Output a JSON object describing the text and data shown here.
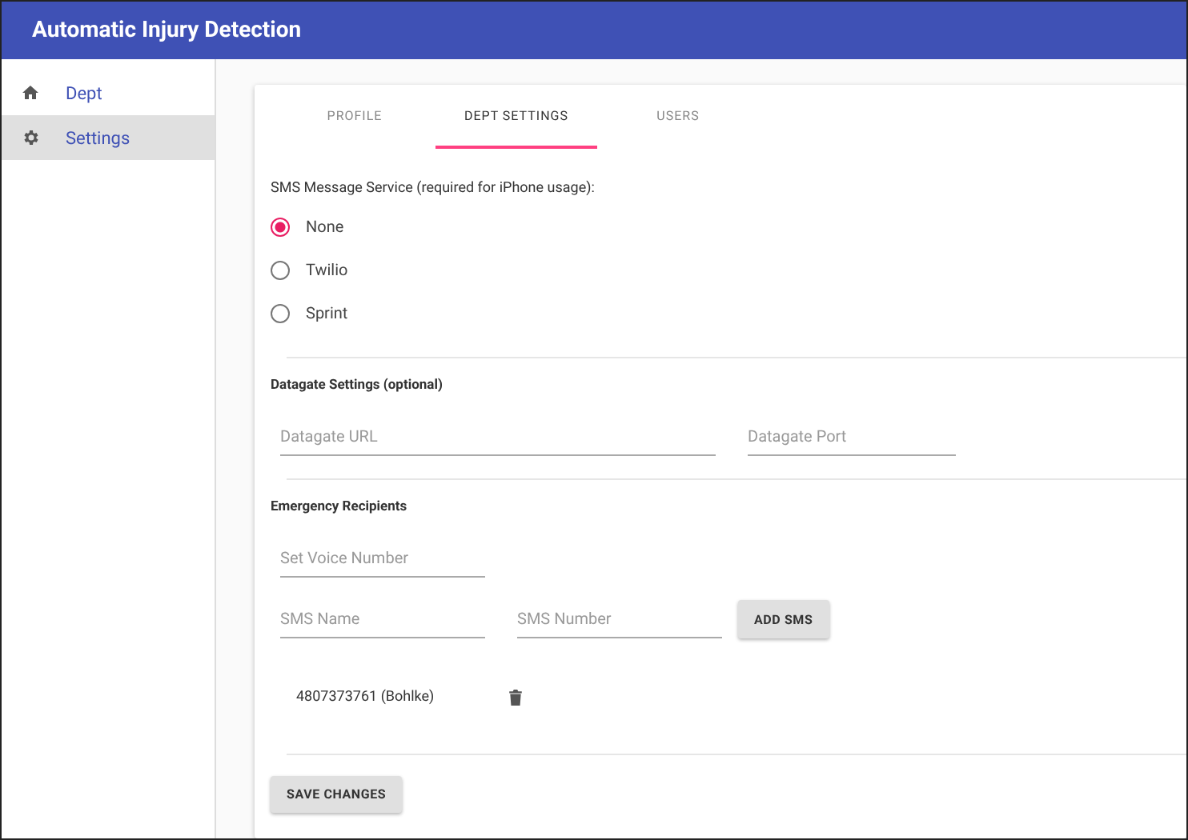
{
  "app_bar": {
    "title": "Automatic Injury Detection"
  },
  "sidebar": {
    "items": [
      {
        "label": "Dept",
        "selected": false
      },
      {
        "label": "Settings",
        "selected": true
      }
    ]
  },
  "tabs": [
    {
      "label": "PROFILE",
      "selected": false
    },
    {
      "label": "DEPT SETTINGS",
      "selected": true
    },
    {
      "label": "USERS",
      "selected": false
    }
  ],
  "sms_service": {
    "label": "SMS Message Service (required for iPhone usage):",
    "options": [
      {
        "label": "None",
        "selected": true
      },
      {
        "label": "Twilio",
        "selected": false
      },
      {
        "label": "Sprint",
        "selected": false
      }
    ]
  },
  "datagate": {
    "title": "Datagate Settings (optional)",
    "url": {
      "placeholder": "Datagate URL"
    },
    "port": {
      "placeholder": "Datagate Port"
    }
  },
  "emergency": {
    "title": "Emergency Recipients",
    "voice_number": {
      "placeholder": "Set Voice Number"
    },
    "sms_name": {
      "placeholder": "SMS Name"
    },
    "sms_number": {
      "placeholder": "SMS Number"
    },
    "add_button": "ADD SMS",
    "recipients": [
      "4807373761 (Bohlke)"
    ]
  },
  "save_button": "SAVE CHANGES"
}
